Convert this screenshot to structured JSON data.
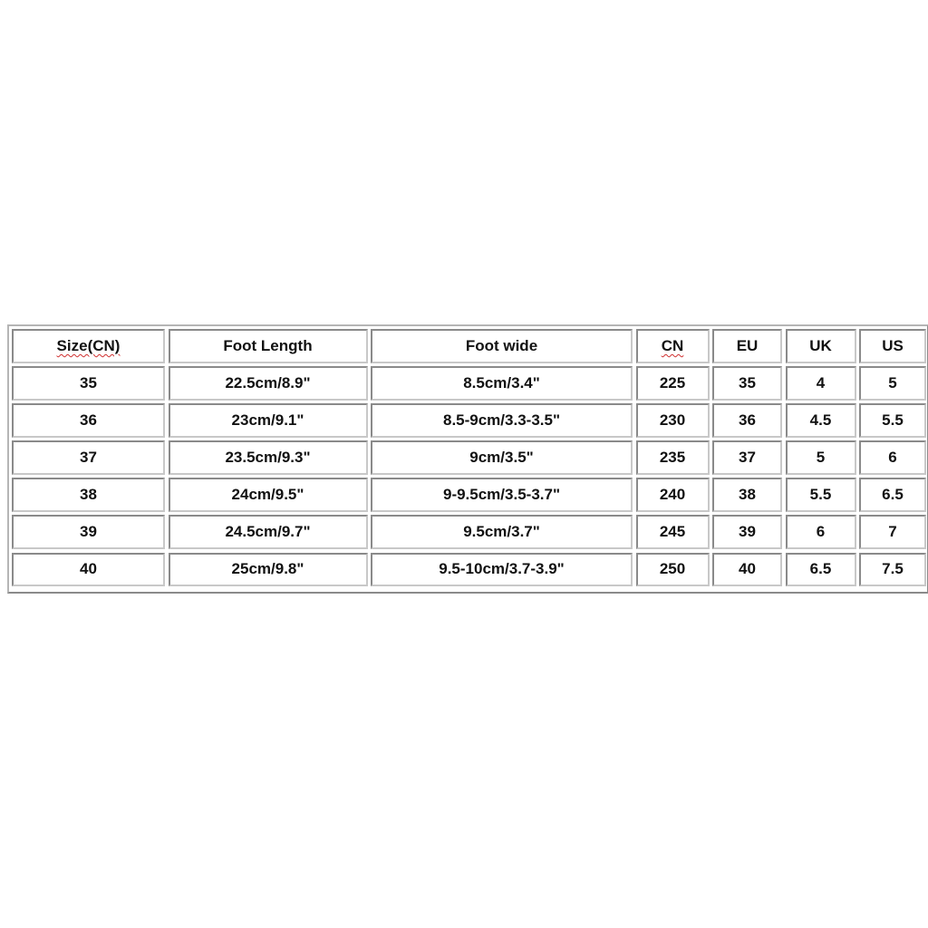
{
  "size_chart": {
    "headers": [
      "Size(CN)",
      "Foot Length",
      "Foot wide",
      "CN",
      "EU",
      "UK",
      "US"
    ],
    "rows": [
      [
        "35",
        "22.5cm/8.9\"",
        "8.5cm/3.4\"",
        "225",
        "35",
        "4",
        "5"
      ],
      [
        "36",
        "23cm/9.1\"",
        "8.5-9cm/3.3-3.5\"",
        "230",
        "36",
        "4.5",
        "5.5"
      ],
      [
        "37",
        "23.5cm/9.3\"",
        "9cm/3.5\"",
        "235",
        "37",
        "5",
        "6"
      ],
      [
        "38",
        "24cm/9.5\"",
        "9-9.5cm/3.5-3.7\"",
        "240",
        "38",
        "5.5",
        "6.5"
      ],
      [
        "39",
        "24.5cm/9.7\"",
        "9.5cm/3.7\"",
        "245",
        "39",
        "6",
        "7"
      ],
      [
        "40",
        "25cm/9.8\"",
        "9.5-10cm/3.7-3.9\"",
        "250",
        "40",
        "6.5",
        "7.5"
      ]
    ]
  }
}
